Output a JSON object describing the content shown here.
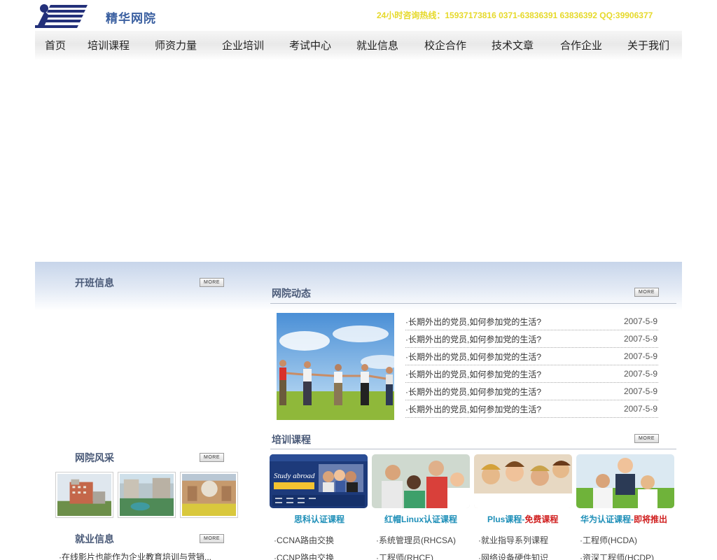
{
  "header": {
    "site_name": "精华网院",
    "hotline": "24小时咨询热线：15937173816  0371-63836391  63836392  QQ:39906377"
  },
  "nav": {
    "items": [
      "首页",
      "培训课程",
      "师资力量",
      "企业培训",
      "考试中心",
      "就业信息",
      "校企合作",
      "技术文章",
      "合作企业",
      "关于我们"
    ]
  },
  "sections": {
    "class_info": "开班信息",
    "school_news": "网院动态",
    "school_style": "网院风采",
    "courses": "培训课程",
    "job_info": "就业信息",
    "more_label": "MORE"
  },
  "news": [
    {
      "title": "·长期外出的党员,如何参加党的生活?",
      "date": "2007-5-9"
    },
    {
      "title": "·长期外出的党员,如何参加党的生活?",
      "date": "2007-5-9"
    },
    {
      "title": "·长期外出的党员,如何参加党的生活?",
      "date": "2007-5-9"
    },
    {
      "title": "·长期外出的党员,如何参加党的生活?",
      "date": "2007-5-9"
    },
    {
      "title": "·长期外出的党员,如何参加党的生活?",
      "date": "2007-5-9"
    },
    {
      "title": "·长期外出的党员,如何参加党的生活?",
      "date": "2007-5-9"
    }
  ],
  "courses": [
    {
      "name": "思科认证课程",
      "name_red": "",
      "items": [
        "·CCNA路由交换",
        "·CCNP路由交换"
      ],
      "banner_text": "Study abroad"
    },
    {
      "name": "红帽Linux认证课程",
      "name_red": "",
      "items": [
        "·系统管理员(RHCSA)",
        "·工程师(RHCE)"
      ]
    },
    {
      "name": "Plus课程-",
      "name_red": "免费课程",
      "items": [
        "·就业指导系列课程",
        "·网络设备硬件知识"
      ]
    },
    {
      "name": "华为认证课程-",
      "name_red": "即将推出",
      "items": [
        "·工程师(HCDA)",
        "·资深工程师(HCDP)"
      ]
    }
  ],
  "jobs": [
    "·在线影片也能作为企业教育培训与营销..."
  ],
  "colors": {
    "accent_blue": "#3a5fa0",
    "hotline_yellow": "#e6d92a",
    "course_blue": "#1e8fb8",
    "course_red": "#d02020"
  }
}
